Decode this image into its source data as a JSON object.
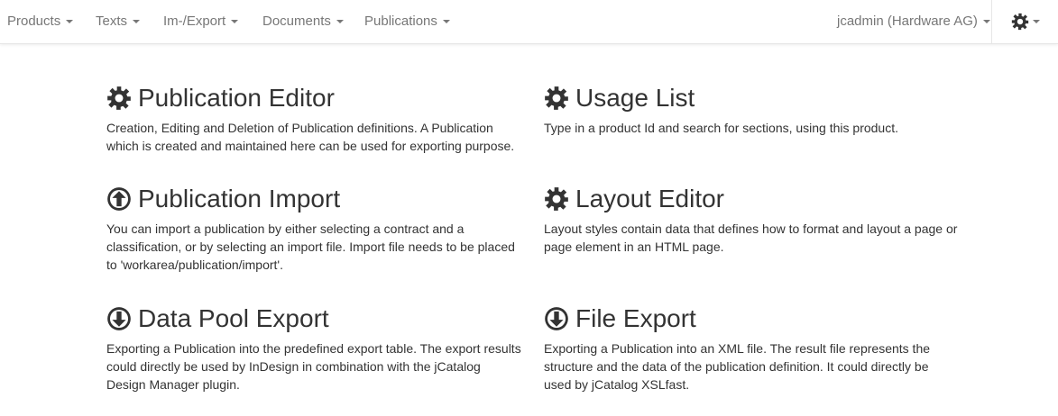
{
  "colors": {
    "nav_text": "#777777",
    "title_text": "#333333",
    "icon": "#333333"
  },
  "navbar": {
    "menus": [
      {
        "label": "Products"
      },
      {
        "label": "Texts"
      },
      {
        "label": "Im-/Export"
      },
      {
        "label": "Documents"
      },
      {
        "label": "Publications"
      }
    ],
    "user_label": "jcadmin (Hardware AG)",
    "settings_icon": "gear-icon"
  },
  "cards": [
    {
      "title": "Publication Editor",
      "icon": "gear-icon",
      "description": "Creation, Editing and Deletion of Publication definitions. A Publication which is created and maintained here can be used for exporting purpose."
    },
    {
      "title": "Usage List",
      "icon": "gear-icon",
      "description": "Type in a product Id and search for sections, using this product."
    },
    {
      "title": "Publication Import",
      "icon": "circle-arrow-up-icon",
      "description": "You can import a publication by either selecting a contract and a classification, or by selecting an import file. Import file needs to be placed to 'workarea/publication/import'."
    },
    {
      "title": "Layout Editor",
      "icon": "gear-icon",
      "description": "Layout styles contain data that defines how to format and layout a page or page element in an HTML page."
    },
    {
      "title": "Data Pool Export",
      "icon": "circle-arrow-down-icon",
      "description": "Exporting a Publication into the predefined export table. The export results could directly be used by InDesign in combination with the jCatalog Design Manager plugin."
    },
    {
      "title": "File Export",
      "icon": "circle-arrow-down-icon",
      "description": "Exporting a Publication into an XML file. The result file represents the structure and the data of the publication definition. It could directly be used by jCatalog XSLfast."
    }
  ]
}
